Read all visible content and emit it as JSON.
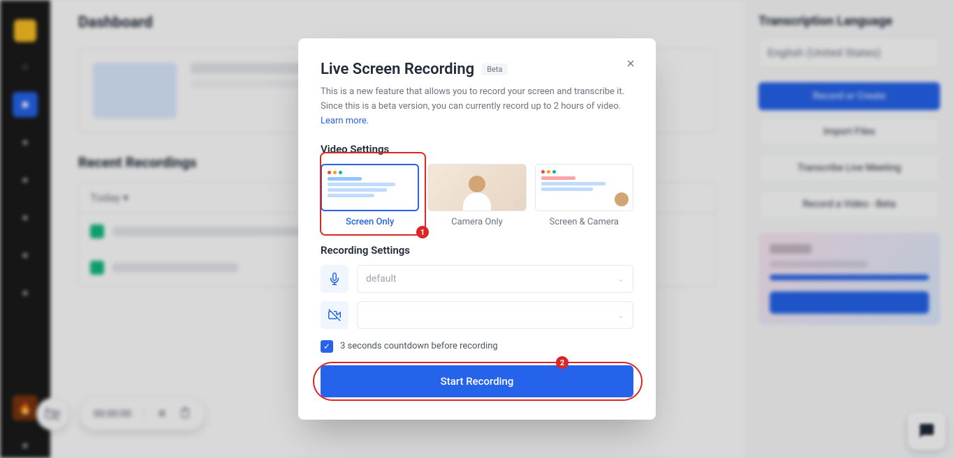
{
  "page": {
    "title": "Dashboard",
    "section_title": "Recent Recordings"
  },
  "sidebar": {
    "items": []
  },
  "right_panel": {
    "title": "Transcription Language",
    "dropdown": "English (United States)",
    "buttons": {
      "record": "Record or Create",
      "import": "Import Files",
      "transcribe": "Transcribe Live Meeting",
      "youtube": "Record a Video - Beta"
    }
  },
  "modal": {
    "title": "Live Screen Recording",
    "badge": "Beta",
    "description": "This is a new feature that allows you to record your screen and transcribe it. Since this is a beta version, you can currently record up to 2 hours of video. ",
    "learn_more": "Learn more.",
    "video_settings_label": "Video Settings",
    "video_options": {
      "screen_only": "Screen Only",
      "camera_only": "Camera Only",
      "screen_camera": "Screen & Camera"
    },
    "recording_settings_label": "Recording Settings",
    "mic_select": "default",
    "camera_select": "",
    "countdown_label": "3 seconds countdown before recording",
    "start_button": "Start Recording"
  },
  "floating": {
    "timer": "00:00:00"
  },
  "annotations": {
    "a1": "1",
    "a2": "2"
  }
}
